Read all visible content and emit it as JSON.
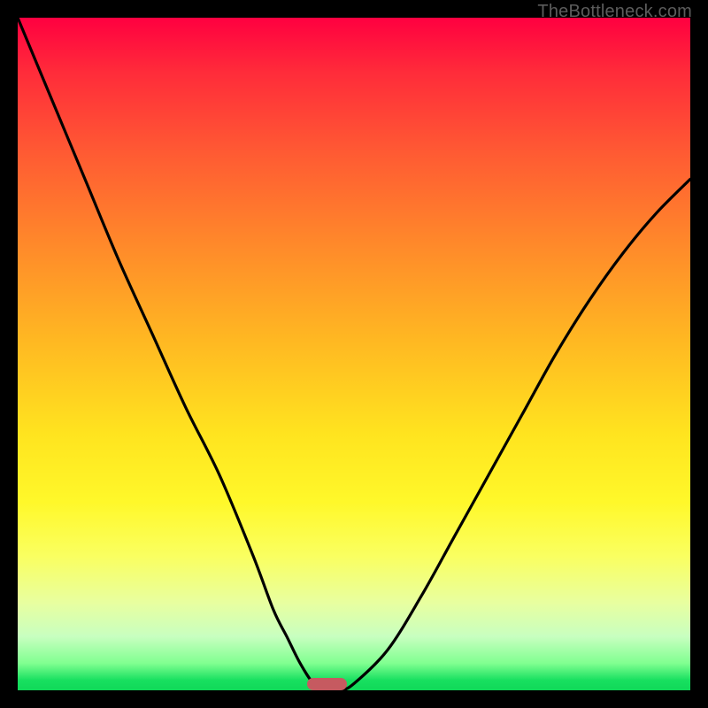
{
  "watermark": "TheBottleneck.com",
  "chart_data": {
    "type": "line",
    "title": "",
    "xlabel": "",
    "ylabel": "",
    "xlim": [
      0,
      100
    ],
    "ylim": [
      0,
      100
    ],
    "grid": false,
    "legend": false,
    "series": [
      {
        "name": "bottleneck-curve",
        "x": [
          0,
          5,
          10,
          15,
          20,
          25,
          30,
          35,
          38,
          40,
          42,
          44,
          46,
          48,
          50,
          55,
          60,
          65,
          70,
          75,
          80,
          85,
          90,
          95,
          100
        ],
        "values": [
          100,
          88,
          76,
          64,
          53,
          42,
          32,
          20,
          12,
          8,
          4,
          1,
          0,
          0,
          1,
          6,
          14,
          23,
          32,
          41,
          50,
          58,
          65,
          71,
          76
        ]
      }
    ],
    "marker": {
      "x_start": 43,
      "x_end": 49,
      "y": 0
    },
    "gradient_stops": [
      {
        "pos": 0,
        "color": "#ff0040"
      },
      {
        "pos": 50,
        "color": "#ffd020"
      },
      {
        "pos": 85,
        "color": "#f8ff70"
      },
      {
        "pos": 100,
        "color": "#10d858"
      }
    ]
  }
}
